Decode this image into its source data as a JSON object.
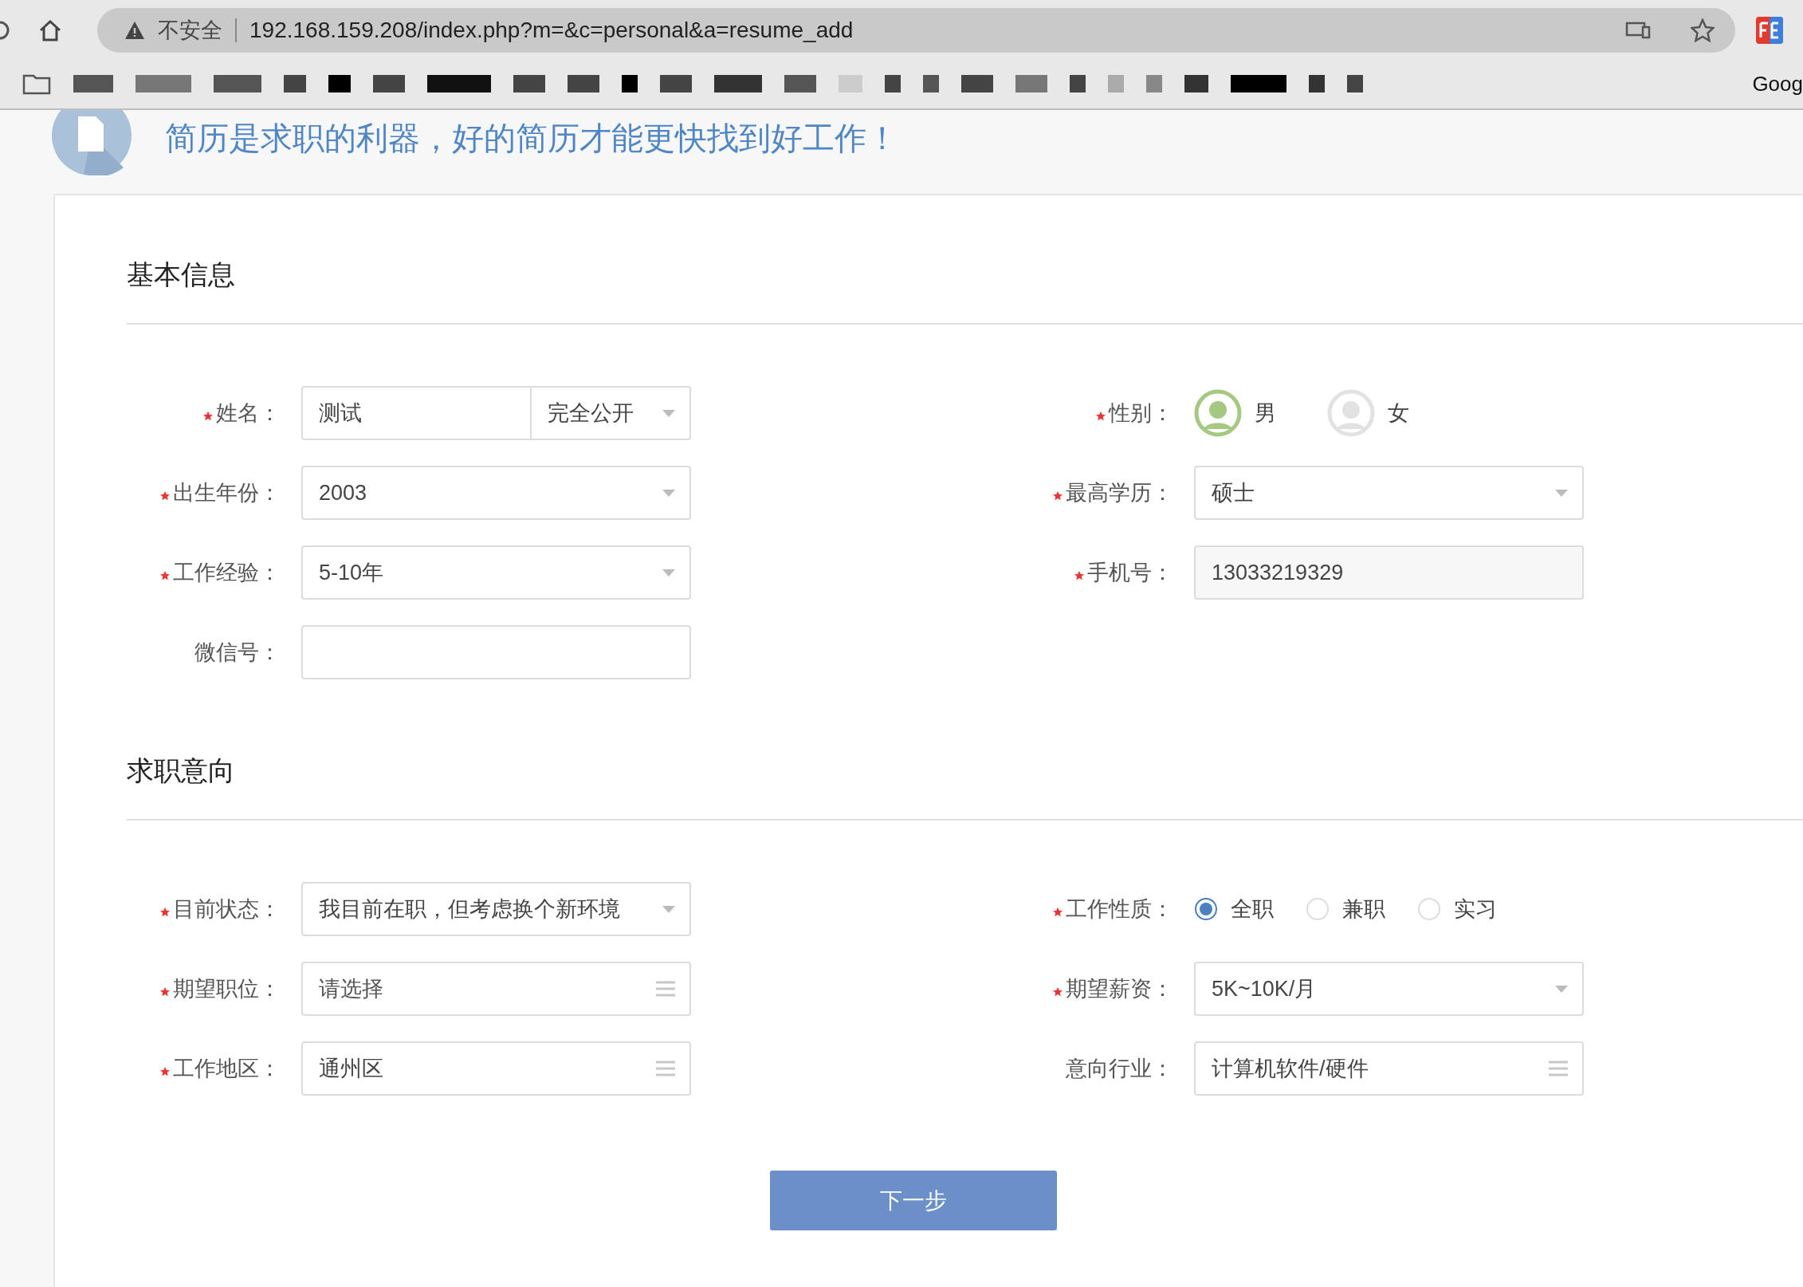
{
  "browser": {
    "security_label": "不安全",
    "url": "192.168.159.208/index.php?m=&c=personal&a=resume_add",
    "bookmarks_partial": "Goog"
  },
  "banner": {
    "title": "简历是求职的利器，好的简历才能更快找到好工作！"
  },
  "sections": [
    {
      "title": "基本信息",
      "fields": [
        {
          "kind": "text_privacy",
          "label": "姓名：",
          "required": true,
          "value": "测试",
          "privacy": "完全公开"
        },
        {
          "kind": "gender",
          "label": "性别：",
          "required": true,
          "options": [
            {
              "label": "男",
              "selected": true
            },
            {
              "label": "女",
              "selected": false
            }
          ]
        },
        {
          "kind": "select",
          "label": "出生年份：",
          "required": true,
          "value": "2003"
        },
        {
          "kind": "select",
          "label": "最高学历：",
          "required": true,
          "value": "硕士"
        },
        {
          "kind": "select",
          "label": "工作经验：",
          "required": true,
          "value": "5-10年"
        },
        {
          "kind": "readonly",
          "label": "手机号：",
          "required": true,
          "value": "13033219329"
        },
        {
          "kind": "text",
          "label": "微信号：",
          "required": false
        }
      ]
    },
    {
      "title": "求职意向",
      "fields": [
        {
          "kind": "select",
          "label": "目前状态：",
          "required": true,
          "value": "我目前在职，但考虑换个新环境"
        },
        {
          "kind": "radio",
          "label": "工作性质：",
          "required": true,
          "options": [
            {
              "label": "全职",
              "selected": true
            },
            {
              "label": "兼职",
              "selected": false
            },
            {
              "label": "实习",
              "selected": false
            }
          ]
        },
        {
          "kind": "picker",
          "label": "期望职位：",
          "required": true,
          "placeholder": "请选择"
        },
        {
          "kind": "select",
          "label": "期望薪资：",
          "required": true,
          "value": "5K~10K/月"
        },
        {
          "kind": "picker",
          "label": "工作地区：",
          "required": true,
          "value": "通州区"
        },
        {
          "kind": "picker",
          "label": "意向行业：",
          "required": false,
          "value": "计算机软件/硬件"
        }
      ]
    }
  ],
  "next_button": "下一步"
}
